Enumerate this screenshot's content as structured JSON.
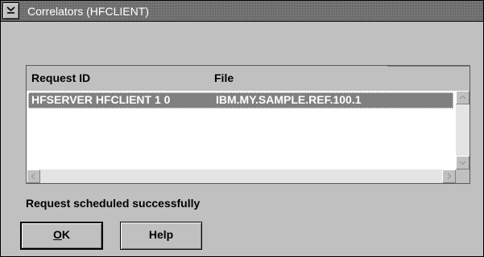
{
  "window": {
    "title": "Correlators (HFCLIENT)",
    "system_menu_icon": "system-menu-icon"
  },
  "list": {
    "columns": [
      "Request ID",
      "File"
    ],
    "rows": [
      {
        "request_id": "HFSERVER HFCLIENT 1 0",
        "file": "IBM.MY.SAMPLE.REF.100.1",
        "selected": true
      }
    ],
    "scroll_icons": [
      "scroll-up-icon",
      "scroll-down-icon",
      "scroll-left-icon",
      "scroll-right-icon"
    ]
  },
  "status": {
    "message": "Request scheduled successfully"
  },
  "buttons": {
    "ok": {
      "mnemonic": "O",
      "rest": "K"
    },
    "help": "Help"
  },
  "colors": {
    "face": "#c0c0c0",
    "selection": "#808080",
    "list_background": "#ffffff",
    "title_text": "#ffffff"
  }
}
